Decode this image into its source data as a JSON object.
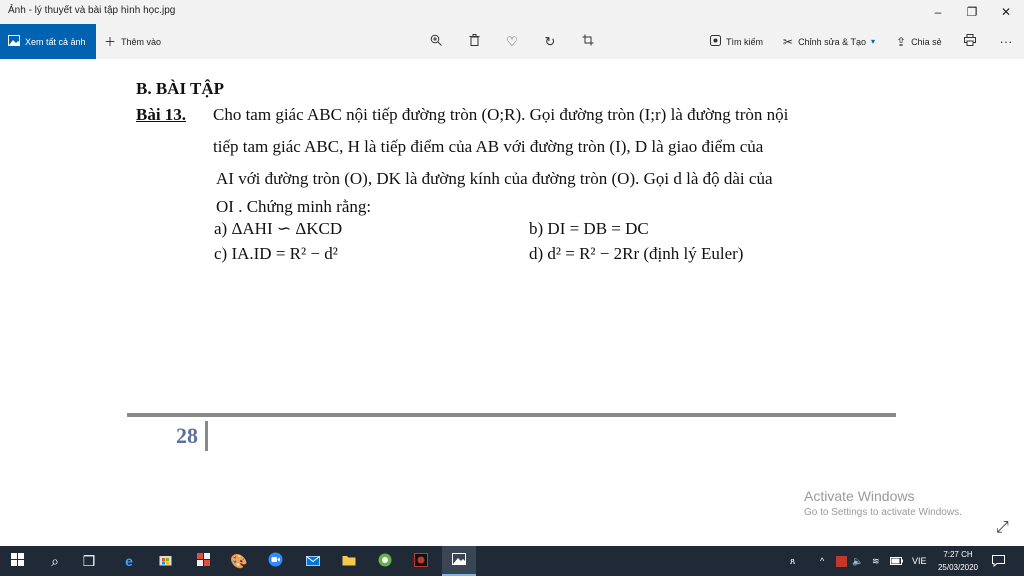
{
  "window": {
    "title": "Ảnh - lý thuyết và bài tập hình học.jpg"
  },
  "controls": {
    "minimize": "–",
    "restore": "❐",
    "close": "✕"
  },
  "toolbar": {
    "see_all": "Xem tất cả ảnh",
    "add": "Thêm vào",
    "search": "Tìm kiếm",
    "edit_create": "Chỉnh sửa & Tạo",
    "share": "Chia sẻ",
    "more": "···"
  },
  "document": {
    "heading": "B. BÀI TẬP",
    "problem_label": "Bài 13.",
    "lines": [
      "Cho tam giác ABC nội tiếp đường tròn (O;R). Gọi đường tròn (I;r) là đường tròn nội",
      "tiếp tam giác ABC, H là tiếp điểm của AB với đường tròn (I), D là giao điểm của",
      "AI với đường tròn (O), DK là đường kính của đường tròn (O). Gọi d là độ dài của",
      "OI . Chứng minh rằng:"
    ],
    "items": {
      "a": "a) ΔAHI ∽ ΔKCD",
      "b": "b) DI = DB = DC",
      "c": "c) IA.ID = R² − d²",
      "d": "d) d² = R² − 2Rr  (định lý Euler)"
    },
    "page_number": "28"
  },
  "watermark": {
    "line1": "Activate Windows",
    "line2": "Go to Settings to activate Windows."
  },
  "taskbar": {
    "language": "VIE",
    "time": "7:27 CH",
    "date": "25/03/2020"
  }
}
